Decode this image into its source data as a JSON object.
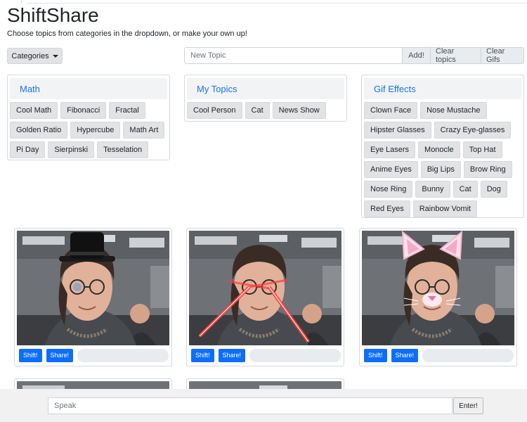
{
  "app": {
    "title": "ShiftShare",
    "subtitle": "Choose topics from categories in the dropdown, or make your own up!"
  },
  "controls": {
    "categories_label": "Categories",
    "new_topic_placeholder": "New Topic",
    "add_label": "Add!",
    "clear_topics_label": "Clear topics",
    "clear_gifs_label": "Clear Gifs"
  },
  "panels": {
    "math": {
      "title": "Math",
      "items": [
        "Cool Math",
        "Fibonacci",
        "Fractal",
        "Golden Ratio",
        "Hypercube",
        "Math Art",
        "Pi Day",
        "Sierpinski",
        "Tesselation"
      ]
    },
    "my_topics": {
      "title": "My Topics",
      "items": [
        "Cool Person",
        "Cat",
        "News Show"
      ]
    },
    "gif_effects": {
      "title": "Gif Effects",
      "items": [
        "Clown Face",
        "Nose Mustache",
        "Hipster Glasses",
        "Crazy Eye-glasses",
        "Eye Lasers",
        "Monocle",
        "Top Hat",
        "Anime Eyes",
        "Big Lips",
        "Brow Ring",
        "Nose Ring",
        "Bunny",
        "Cat",
        "Dog",
        "Red Eyes",
        "Rainbow Vomit"
      ]
    }
  },
  "gif_cards": [
    {
      "effect": "Top Hat",
      "shift_label": "Shift!",
      "share_label": "Share!"
    },
    {
      "effect": "Eye Lasers",
      "shift_label": "Shift!",
      "share_label": "Share!"
    },
    {
      "effect": "Cat",
      "shift_label": "Shift!",
      "share_label": "Share!"
    }
  ],
  "footer": {
    "speak_placeholder": "Speak",
    "enter_label": "Enter!"
  },
  "colors": {
    "accent": "#1a73e8",
    "primary_button": "#0d6efd",
    "chip_bg": "#e2e3e5",
    "laser_red": "#e01515",
    "ear_pink": "#f4a9c8"
  }
}
